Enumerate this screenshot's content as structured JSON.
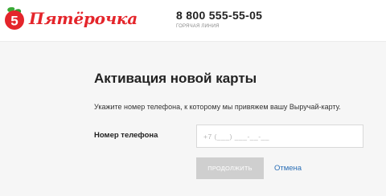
{
  "header": {
    "brand_name": "Пятёрочка",
    "hotline_phone": "8 800 555-55-05",
    "hotline_caption": "ГОРЯЧАЯ ЛИНИЯ",
    "brand_color": "#e4252b",
    "logo_icon": "pyaterochka-logo-icon"
  },
  "form": {
    "title": "Активация новой карты",
    "hint": "Укажите номер телефона, к которому мы привяжем вашу Выручай-карту.",
    "phone_label": "Номер телефона",
    "phone_value": "",
    "phone_placeholder": "+7 (___) ___-__-__",
    "submit_label": "Продолжить",
    "cancel_label": "Отмена",
    "link_color": "#2b6fb6"
  }
}
